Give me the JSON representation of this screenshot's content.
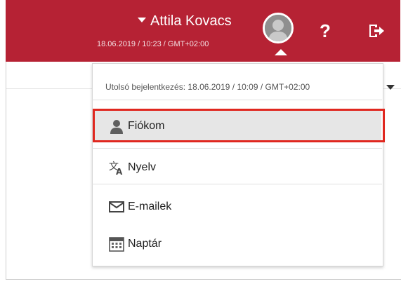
{
  "header": {
    "username": "Attila Kovacs",
    "datetime": "18.06.2019 / 10:23 / GMT+02:00",
    "help_label": "?",
    "brand_color": "#b62234"
  },
  "dropdown": {
    "last_login": "Utolsó bejelentkezés: 18.06.2019 / 10:09 / GMT+02:00",
    "items": [
      {
        "label": "Fiókom",
        "icon": "user-icon",
        "selected": true
      },
      {
        "label": "Nyelv",
        "icon": "translate-icon"
      },
      {
        "label": "E-mailek",
        "icon": "envelope-icon"
      },
      {
        "label": "Naptár",
        "icon": "calendar-icon"
      }
    ],
    "highlight_color": "#e0271f"
  }
}
